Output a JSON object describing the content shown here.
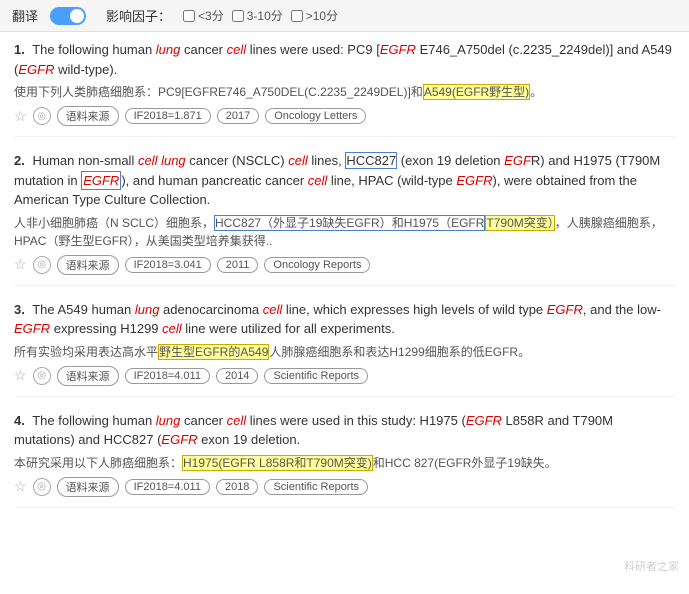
{
  "topbar": {
    "translate_label": "翻译",
    "impact_label": "影响因子：",
    "filter1": "<3分",
    "filter2": "3-10分",
    "filter3": ">10分"
  },
  "results": [
    {
      "number": "1.",
      "en_parts": [
        {
          "text": "The following human ",
          "type": "normal"
        },
        {
          "text": "lung",
          "type": "italic"
        },
        {
          "text": " cancer ",
          "type": "normal"
        },
        {
          "text": "cell",
          "type": "italic"
        },
        {
          "text": " lines were used: PC9 [",
          "type": "normal"
        },
        {
          "text": "EGFR",
          "type": "italic-red"
        },
        {
          "text": " E746_A750del (c.2235_2249del)] and A549 (",
          "type": "normal"
        },
        {
          "text": "EGFR",
          "type": "italic-red"
        },
        {
          "text": " wild-type).",
          "type": "normal"
        }
      ],
      "cn": "使用下列人类肺癌细胞系：PC9[EGFRE746_A750DEL(C.2235_2249DEL)]和",
      "cn_highlight": "A549(EGFR野生型)。",
      "cn_after": "",
      "meta": {
        "if_value": "IF2018=1.871",
        "year": "2017",
        "journal": "Oncology Letters"
      }
    },
    {
      "number": "2.",
      "en_parts": [
        {
          "text": "Human non-small ",
          "type": "normal"
        },
        {
          "text": "cell lung",
          "type": "italic"
        },
        {
          "text": " cancer (NSCLC) ",
          "type": "normal"
        },
        {
          "text": "cell",
          "type": "italic"
        },
        {
          "text": " lines, ",
          "type": "normal"
        },
        {
          "text": "HCC827",
          "type": "highlight-blue"
        },
        {
          "text": " (exon 19 deletion ",
          "type": "normal"
        },
        {
          "text": "EGF",
          "type": "italic-red"
        },
        {
          "text": "\nR) and H1975 (T790M mutation in ",
          "type": "normal"
        },
        {
          "text": "EGFR",
          "type": "italic-red-blue"
        },
        {
          "text": "), and human pancreatic cancer ",
          "type": "normal"
        },
        {
          "text": "cell",
          "type": "italic"
        },
        {
          "text": " line, HPAC (wild-type ",
          "type": "normal"
        },
        {
          "text": "EGFR",
          "type": "italic-red"
        },
        {
          "text": "), were obtained from the American Type Culture Collection.",
          "type": "normal"
        }
      ],
      "cn": "人非小细胞肺癌（N SCLC）细胞系，",
      "cn_highlight": "HCC827（外显子19缺失EGFR）和H1975（EGFR",
      "cn_highlight2": "T790M突变）",
      "cn_after": "，人胰腺癌细胞系，HPAC（野生型EGFR），从美国类型培养集获得..",
      "meta": {
        "if_value": "IF2018=3.041",
        "year": "2011",
        "journal": "Oncology Reports"
      }
    },
    {
      "number": "3.",
      "en_parts": [
        {
          "text": "The A549 human ",
          "type": "normal"
        },
        {
          "text": "lung",
          "type": "italic"
        },
        {
          "text": " adenocarcinoma ",
          "type": "normal"
        },
        {
          "text": "cell",
          "type": "italic"
        },
        {
          "text": " line, which expresses high levels of wild type ",
          "type": "normal"
        },
        {
          "text": "EGFR",
          "type": "italic-red"
        },
        {
          "text": ", and the low-",
          "type": "normal"
        },
        {
          "text": "EGFR",
          "type": "italic-red"
        },
        {
          "text": " expressing H1299 ",
          "type": "normal"
        },
        {
          "text": "cell",
          "type": "italic"
        },
        {
          "text": " line were utilized for all experiments.",
          "type": "normal"
        }
      ],
      "cn": "所有实验均采用表达高水平",
      "cn_highlight": "野生型EGFR的A549",
      "cn_after": "人肺腺癌细胞系和表达H1299细胞系的低EGFR。",
      "meta": {
        "if_value": "IF2018=4.011",
        "year": "2014",
        "journal": "Scientific Reports"
      }
    },
    {
      "number": "4.",
      "en_parts": [
        {
          "text": "The following human ",
          "type": "normal"
        },
        {
          "text": "lung",
          "type": "italic"
        },
        {
          "text": " cancer ",
          "type": "normal"
        },
        {
          "text": "cell",
          "type": "italic"
        },
        {
          "text": " lines were used in this study: H1975 (",
          "type": "normal"
        },
        {
          "text": "EGFR",
          "type": "italic-red"
        },
        {
          "text": " L858R and T790M mutations) and HCC827 (",
          "type": "normal"
        },
        {
          "text": "EGFR",
          "type": "italic-red"
        },
        {
          "text": " exon 19 deletion.",
          "type": "normal"
        }
      ],
      "cn": "本研究采用以下人肺癌细胞系：",
      "cn_highlight": "H1975(EGFR L858R和T790M突变)",
      "cn_after": "和HCC 827(EGFR外显子19缺失。",
      "meta": {
        "if_value": "IF2018=4.011",
        "year": "2018",
        "journal": "Scientific Reports"
      }
    }
  ],
  "watermark": "科研者之家",
  "labels": {
    "source": "语料来源"
  }
}
